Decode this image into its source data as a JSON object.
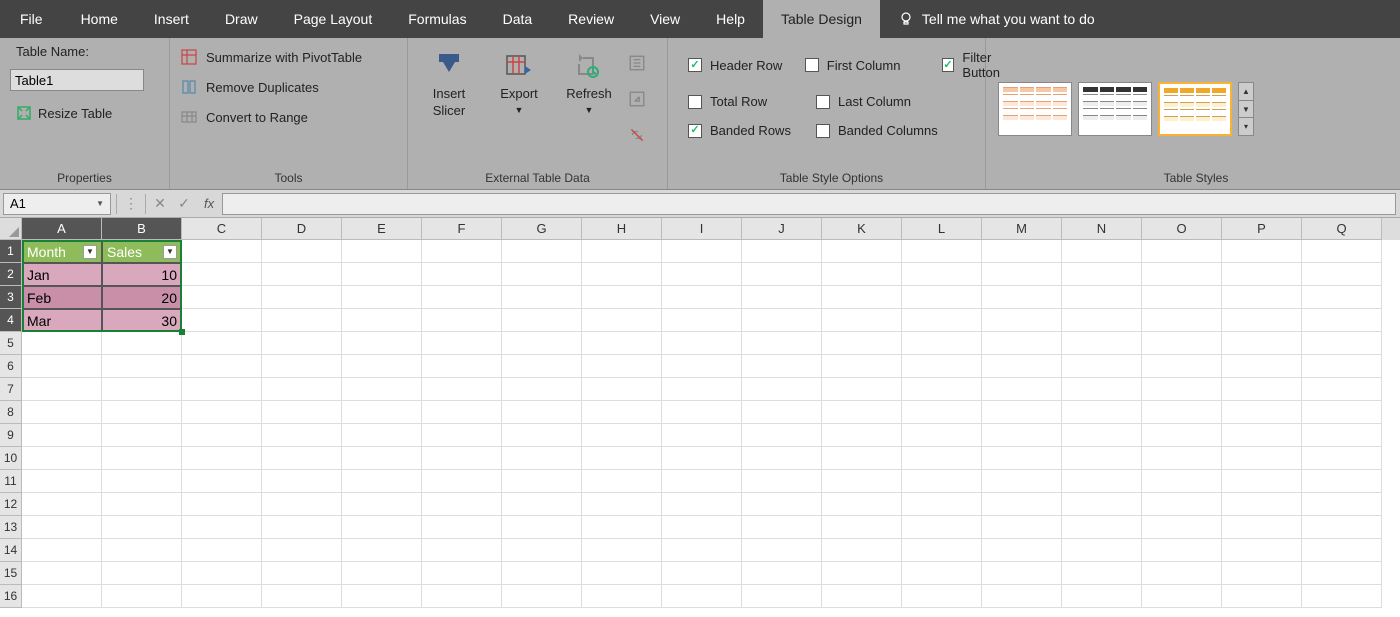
{
  "tabs": [
    "File",
    "Home",
    "Insert",
    "Draw",
    "Page Layout",
    "Formulas",
    "Data",
    "Review",
    "View",
    "Help",
    "Table Design"
  ],
  "active_tab": "Table Design",
  "tell_me": "Tell me what you want to do",
  "groups": {
    "properties": {
      "label": "Properties",
      "tablename_label": "Table Name:",
      "tablename_value": "Table1",
      "resize": "Resize Table"
    },
    "tools": {
      "label": "Tools",
      "pivot": "Summarize with PivotTable",
      "dupes": "Remove Duplicates",
      "range": "Convert to Range"
    },
    "external": {
      "label": "External Table Data",
      "slicer": "Insert Slicer",
      "export": "Export",
      "refresh": "Refresh"
    },
    "styleopt": {
      "label": "Table Style Options",
      "header": "Header Row",
      "total": "Total Row",
      "banded_r": "Banded Rows",
      "first": "First Column",
      "last": "Last Column",
      "banded_c": "Banded Columns",
      "filter": "Filter Button"
    },
    "styles": {
      "label": "Table Styles"
    }
  },
  "checks": {
    "header": true,
    "total": false,
    "banded_r": true,
    "first": false,
    "last": false,
    "banded_c": false,
    "filter": true
  },
  "namebox": "A1",
  "columns": [
    "A",
    "B",
    "C",
    "D",
    "E",
    "F",
    "G",
    "H",
    "I",
    "J",
    "K",
    "L",
    "M",
    "N",
    "O",
    "P",
    "Q"
  ],
  "rows": [
    "1",
    "2",
    "3",
    "4",
    "5",
    "6",
    "7",
    "8",
    "9",
    "10",
    "11",
    "12",
    "13",
    "14",
    "15",
    "16"
  ],
  "table": {
    "headers": [
      "Month",
      "Sales"
    ],
    "data": [
      [
        "Jan",
        "10"
      ],
      [
        "Feb",
        "20"
      ],
      [
        "Mar",
        "30"
      ]
    ]
  }
}
